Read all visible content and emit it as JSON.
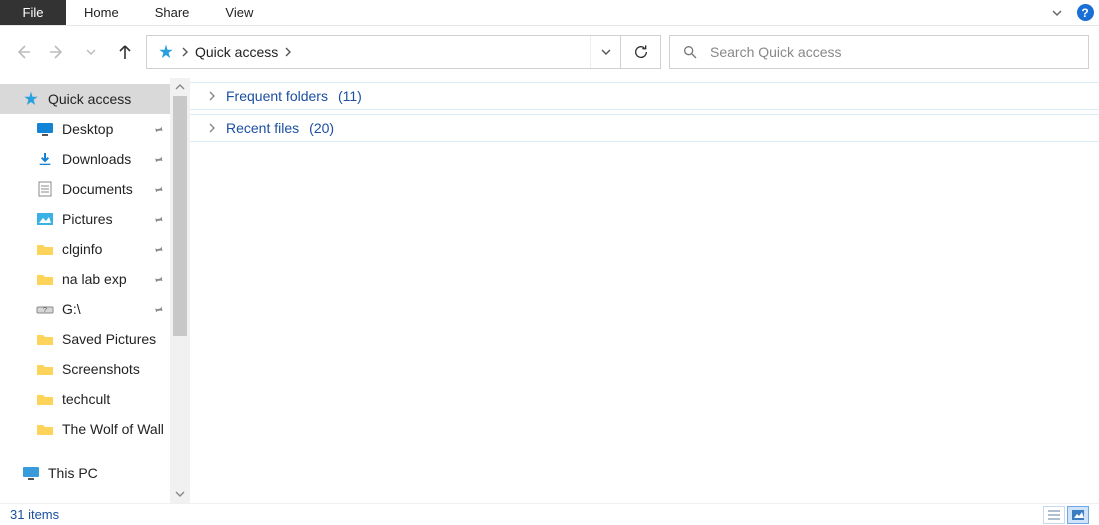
{
  "ribbon": {
    "file": "File",
    "home": "Home",
    "share": "Share",
    "view": "View"
  },
  "address": {
    "location": "Quick access"
  },
  "search": {
    "placeholder": "Search Quick access"
  },
  "sidebar": {
    "quick_access": "Quick access",
    "items": [
      {
        "label": "Desktop",
        "pinned": true
      },
      {
        "label": "Downloads",
        "pinned": true
      },
      {
        "label": "Documents",
        "pinned": true
      },
      {
        "label": "Pictures",
        "pinned": true
      },
      {
        "label": "clginfo",
        "pinned": true
      },
      {
        "label": "na lab exp",
        "pinned": true
      },
      {
        "label": "G:\\",
        "pinned": true
      },
      {
        "label": "Saved Pictures",
        "pinned": false
      },
      {
        "label": "Screenshots",
        "pinned": false
      },
      {
        "label": "techcult",
        "pinned": false
      },
      {
        "label": "The Wolf of Wall",
        "pinned": false
      }
    ],
    "this_pc": "This PC"
  },
  "groups": {
    "frequent": {
      "label": "Frequent folders",
      "count": "(11)"
    },
    "recent": {
      "label": "Recent files",
      "count": "(20)"
    }
  },
  "status": {
    "items": "31 items"
  }
}
